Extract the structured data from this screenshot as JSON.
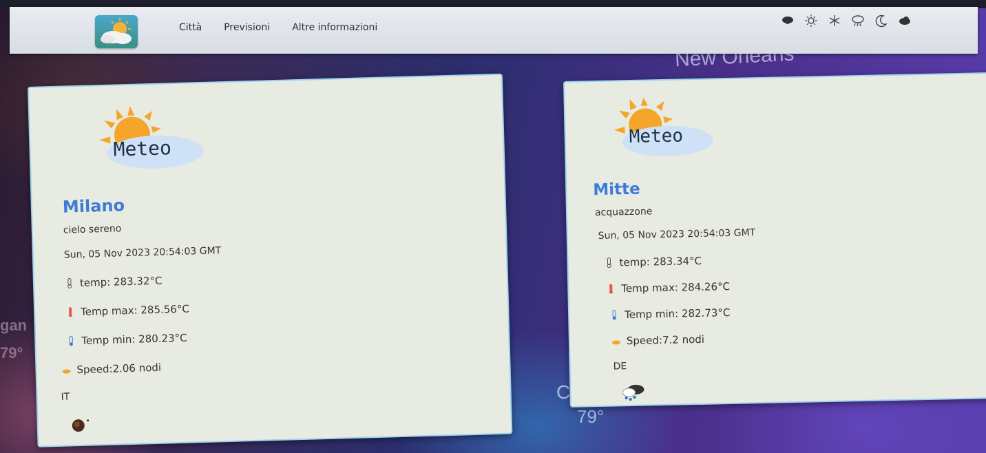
{
  "nav": {
    "links": [
      "Città",
      "Previsioni",
      "Altre informazioni"
    ],
    "icons": [
      "storm-cloud-icon",
      "sun-icon",
      "snowflake-icon",
      "rain-cloud-icon",
      "moon-icon",
      "cloud-icon"
    ]
  },
  "background": {
    "city_label": "New Orleans",
    "left_partial_top": "gan",
    "left_partial_bottom": "79°",
    "cut_label": "Cut",
    "cut_temp": "79°"
  },
  "cards": [
    {
      "logo_text": "Meteo",
      "city": "Milano",
      "description": "cielo sereno",
      "date": "Sun, 05 Nov 2023 20:54:03 GMT",
      "temp": "temp: 283.32°C",
      "temp_max": "Temp max: 285.56°C",
      "temp_min": "Temp min: 280.23°C",
      "speed": "Speed:2.06 nodi",
      "country": "IT",
      "weather_icon": "night-clear-icon"
    },
    {
      "logo_text": "Meteo",
      "city": "Mitte",
      "description": "acquazzone",
      "date": "Sun, 05 Nov 2023 20:54:03 GMT",
      "temp": "temp: 283.34°C",
      "temp_max": "Temp max: 284.26°C",
      "temp_min": "Temp min: 282.73°C",
      "speed": "Speed:7.2 nodi",
      "country": "DE",
      "weather_icon": "shower-rain-icon"
    }
  ],
  "colors": {
    "city_name": "#3d7bd6",
    "card_bg": "#e8ebe1",
    "card_border": "#9fd3f0"
  }
}
